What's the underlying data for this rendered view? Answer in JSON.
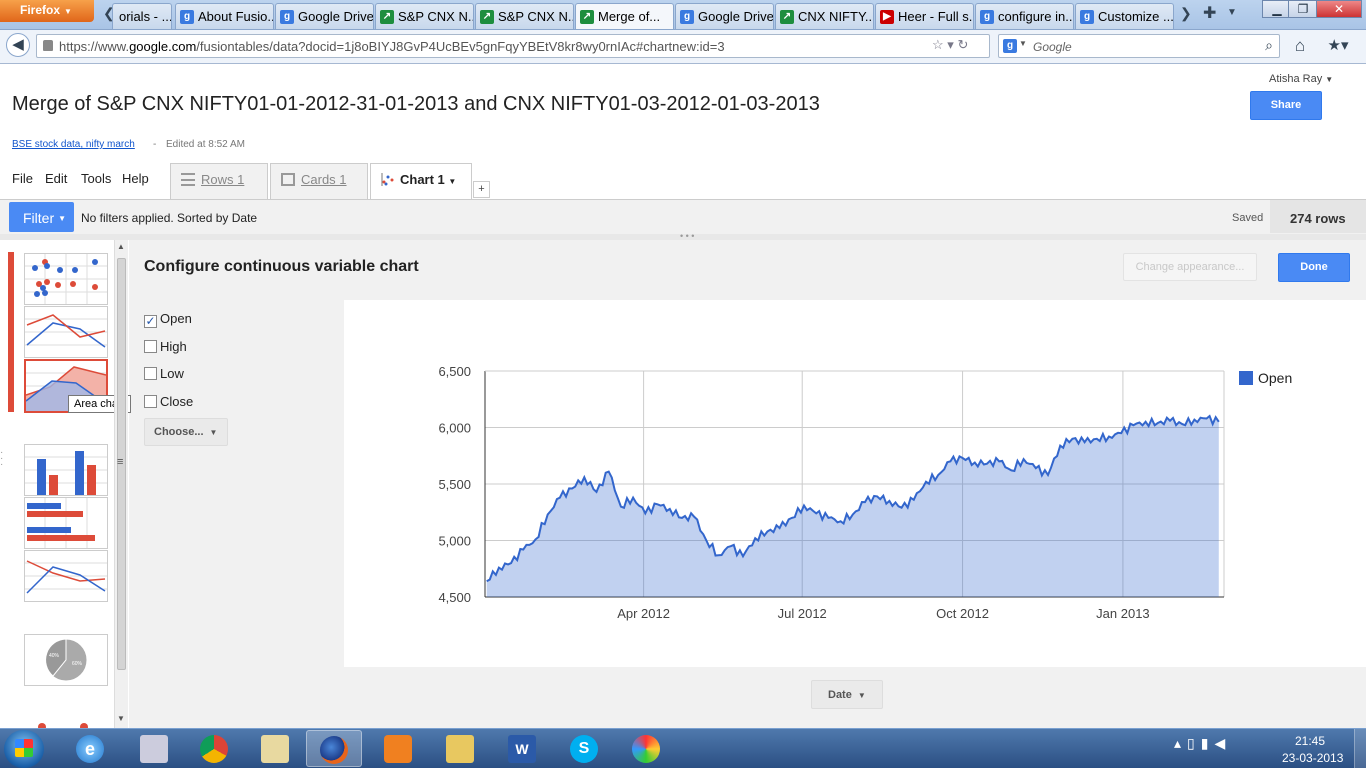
{
  "browser": {
    "menu_button": "Firefox",
    "tabs": [
      {
        "title": "orials - ..."
      },
      {
        "title": "About Fusio..."
      },
      {
        "title": "Google Drive"
      },
      {
        "title": "S&P CNX N..."
      },
      {
        "title": "S&P CNX N..."
      },
      {
        "title": "Merge of..."
      },
      {
        "title": "Google Drive"
      },
      {
        "title": "CNX NIFTY..."
      },
      {
        "title": "Heer - Full s..."
      },
      {
        "title": "configure in..."
      },
      {
        "title": "Customize ..."
      }
    ],
    "url_prefix": "https://www.",
    "url_host": "google.com",
    "url_path": "/fusiontables/data?docid=1j8oBIYJ8GvP4UcBEv5gnFqyYBEtV8kr8wy0rnIAc#chartnew:id=3",
    "search_placeholder": "Google"
  },
  "header": {
    "user": "Atisha Ray",
    "share_label": "Share",
    "title": "Merge of S&P CNX NIFTY01-01-2012-31-01-2013 and CNX NIFTY01-03-2012-01-03-2013",
    "source_link": "BSE stock data, nifty march",
    "dash": "-",
    "edited": "Edited at 8:52 AM"
  },
  "menu": [
    "File",
    "Edit",
    "Tools",
    "Help"
  ],
  "view_tabs": [
    {
      "label": "Rows 1"
    },
    {
      "label": "Cards 1"
    },
    {
      "label": "Chart 1"
    }
  ],
  "add_tab": "+",
  "filterbar": {
    "filter_label": "Filter",
    "status": "No filters applied. Sorted by Date",
    "saved": "Saved",
    "rows": "274 rows"
  },
  "sidebar": {
    "tooltip": "Area chart",
    "pie_labels": [
      "40%",
      "60%"
    ]
  },
  "config": {
    "title": "Configure continuous variable chart",
    "appearance_label": "Change appearance...",
    "done_label": "Done",
    "columns": [
      {
        "label": "Open",
        "checked": true
      },
      {
        "label": "High",
        "checked": false
      },
      {
        "label": "Low",
        "checked": false
      },
      {
        "label": "Close",
        "checked": false
      }
    ],
    "choose_label": "Choose...",
    "x_axis_label": "Date"
  },
  "chart_data": {
    "type": "area",
    "series": [
      {
        "name": "Open",
        "color": "#3366cc",
        "x": [
          "2012-01-02",
          "2012-01-09",
          "2012-01-16",
          "2012-01-23",
          "2012-01-30",
          "2012-02-06",
          "2012-02-13",
          "2012-02-20",
          "2012-02-27",
          "2012-03-05",
          "2012-03-12",
          "2012-03-19",
          "2012-03-26",
          "2012-04-02",
          "2012-04-09",
          "2012-04-16",
          "2012-04-23",
          "2012-04-30",
          "2012-05-07",
          "2012-05-14",
          "2012-05-21",
          "2012-05-28",
          "2012-06-04",
          "2012-06-11",
          "2012-06-18",
          "2012-06-25",
          "2012-07-02",
          "2012-07-09",
          "2012-07-16",
          "2012-07-23",
          "2012-07-30",
          "2012-08-06",
          "2012-08-13",
          "2012-08-20",
          "2012-08-27",
          "2012-09-03",
          "2012-09-10",
          "2012-09-17",
          "2012-09-24",
          "2012-10-01",
          "2012-10-08",
          "2012-10-15",
          "2012-10-22",
          "2012-10-29",
          "2012-11-05",
          "2012-11-12",
          "2012-11-19",
          "2012-11-26",
          "2012-12-03",
          "2012-12-10",
          "2012-12-17",
          "2012-12-24",
          "2012-12-31",
          "2013-01-07",
          "2013-01-14",
          "2013-01-21",
          "2013-01-28",
          "2013-02-04",
          "2013-02-11",
          "2013-02-18",
          "2013-02-25"
        ],
        "values": [
          4640,
          4760,
          4800,
          4920,
          5010,
          5230,
          5380,
          5460,
          5560,
          5430,
          5610,
          5300,
          5380,
          5240,
          5320,
          5280,
          5200,
          5210,
          5000,
          4870,
          4950,
          4860,
          5020,
          5080,
          5110,
          5200,
          5310,
          5240,
          5200,
          5170,
          5230,
          5340,
          5390,
          5350,
          5290,
          5360,
          5520,
          5580,
          5700,
          5730,
          5690,
          5680,
          5700,
          5620,
          5720,
          5640,
          5580,
          5840,
          5900,
          5870,
          5900,
          5920,
          5950,
          6020,
          6050,
          6040,
          6060,
          6030,
          6070,
          6080,
          6050
        ]
      }
    ],
    "xlabel": "Date",
    "x_ticks": [
      "Apr 2012",
      "Jul 2012",
      "Oct 2012",
      "Jan 2013"
    ],
    "y_ticks": [
      "6,500",
      "6,000",
      "5,500",
      "5,000",
      "4,500"
    ],
    "ylim": [
      4500,
      6500
    ],
    "legend": "top-right",
    "grid": true
  },
  "taskbar": {
    "time": "21:45",
    "date": "23-03-2013"
  }
}
